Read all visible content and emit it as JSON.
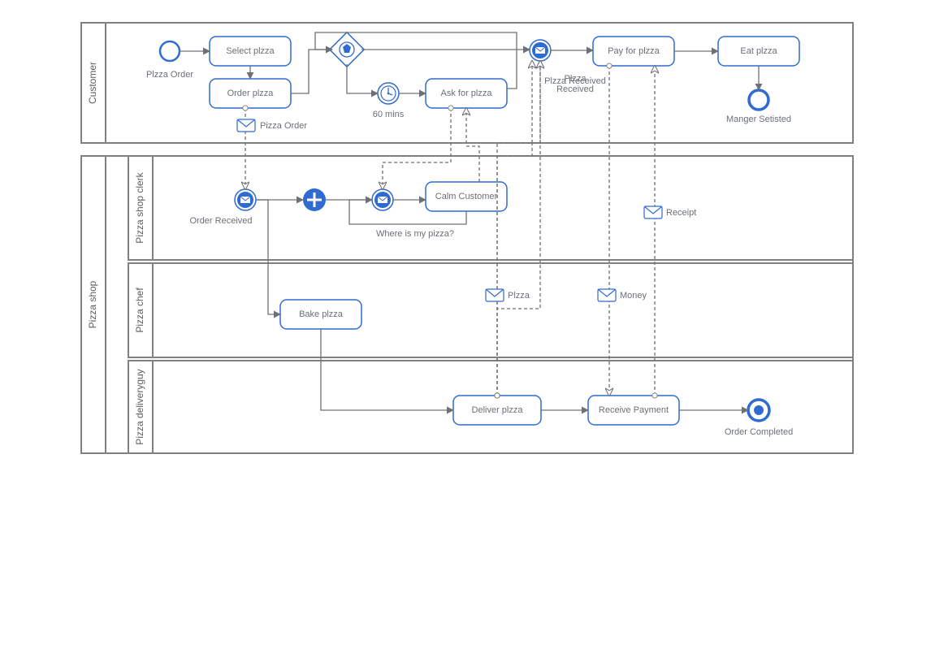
{
  "pools": {
    "customer": "Customer",
    "shop": "Pizza shop"
  },
  "lanes": {
    "clerk": "Pizza shop clerk",
    "chef": "Pizza chef",
    "delivery": "Pizza deliveryguy"
  },
  "tasks": {
    "select_pizza": "Select plzza",
    "order_pizza": "Order plzza",
    "ask_for_pizza": "Ask for plzza",
    "pay_for_pizza": "Pay for plzza",
    "eat_pizza": "Eat plzza",
    "calm_customer": "Calm Customer",
    "bake_pizza": "Bake plzza",
    "deliver_pizza": "Deliver plzza",
    "receive_payment": "Receive Payment"
  },
  "events": {
    "pizza_order_start": "Plzza Order",
    "timer_60": "60 mins",
    "pizza_received": "Plzza Received",
    "hunger_satisfied": "Manger Setisted",
    "order_received": "Order Received",
    "where_is_pizza": "Where is my pizza?",
    "order_completed": "Order Completed"
  },
  "messages": {
    "pizza_order_msg": "Pizza Order",
    "pizza_msg": "Plzza",
    "money_msg": "Money",
    "receipt_msg": "Receipt"
  }
}
